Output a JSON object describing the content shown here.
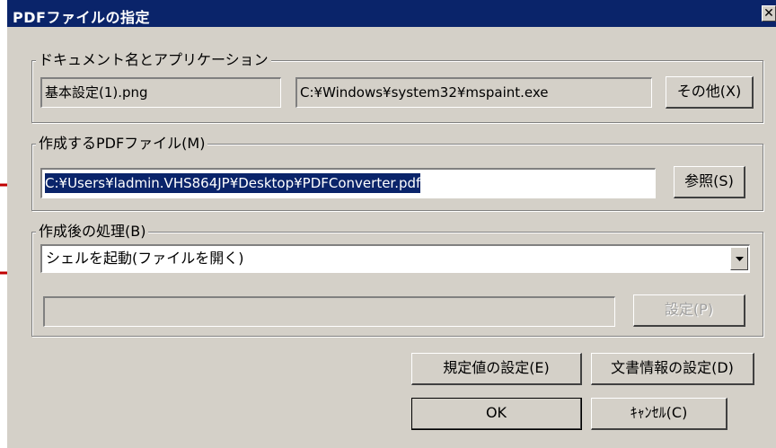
{
  "title": "PDFファイルの指定",
  "close_glyph": "✕",
  "document_group": {
    "legend": "ドキュメント名とアプリケーション",
    "document_name": "基本設定(1).png",
    "application_path": "C:¥Windows¥system32¥mspaint.exe",
    "other_button": "その他(X)"
  },
  "pdf_group": {
    "legend": "作成するPDFファイル(M)",
    "path": "C:¥Users¥ladmin.VHS864JP¥Desktop¥PDFConverter.pdf",
    "browse_button": "参照(S)"
  },
  "post_group": {
    "legend": "作成後の処理(B)",
    "selected_action": "シェルを起動(ファイルを開く)",
    "command_value": "",
    "settings_button": "設定(P)"
  },
  "buttons": {
    "defaults": "規定値の設定(E)",
    "doc_info": "文書情報の設定(D)",
    "ok": "OK",
    "cancel": "ｷｬﾝｾﾙ(C)"
  },
  "colors": {
    "titlebar": "#0a246a",
    "face": "#d4d0c8",
    "annotation_arrow": "#c00000"
  }
}
